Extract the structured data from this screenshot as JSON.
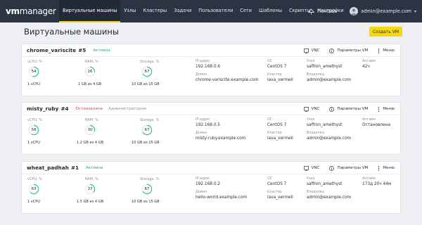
{
  "brand": {
    "logo_vm": "vm",
    "logo_manager": "manager"
  },
  "nav": [
    {
      "label": "Виртуальные машины",
      "active": true
    },
    {
      "label": "Узлы"
    },
    {
      "label": "Кластеры"
    },
    {
      "label": "Задачи"
    },
    {
      "label": "Пользователи"
    },
    {
      "label": "Сети"
    },
    {
      "label": "Шаблоны"
    },
    {
      "label": "Скрипты"
    },
    {
      "label": "Настройки"
    }
  ],
  "header": {
    "help_label": "Помощь",
    "user_email": "admin@example.com"
  },
  "page": {
    "title": "Виртуальные машины",
    "create_button": "Создать VM"
  },
  "labels": {
    "vcpu": "vCPU, %",
    "ram": "RAM, %",
    "storage": "Storage, %",
    "ip": "IP-адрес",
    "domain": "Домен",
    "os": "ОС",
    "cluster": "Кластер",
    "node": "Узел",
    "owner": "Владелец",
    "uptime": "Аптайм",
    "vnc": "VNC",
    "params": "Параметры VM",
    "menu": "Меню"
  },
  "vms": [
    {
      "name": "chrome_variscite",
      "number": "#5",
      "status": "Активна",
      "status_kind": "ok",
      "status_sub": "",
      "cpu_pct": "54",
      "cpu_foot": "1 vCPU",
      "ram_pct": "26",
      "ram_foot": "1 GB из 4 GB",
      "storage_pct": "67",
      "storage_foot": "10 GB из 15 GB",
      "ip": "192.168.0.6",
      "domain": "chrome-variscite.example.com",
      "os": "CentOS 7",
      "cluster": "lava_vermeil",
      "node": "saffron_amethyst",
      "owner": "admin@example.com",
      "uptime": "42ч"
    },
    {
      "name": "misty_ruby",
      "number": "#4",
      "status": "Остановлена",
      "status_kind": "off",
      "status_sub": "Администратором",
      "cpu_pct": "58",
      "cpu_foot": "1 vCPU",
      "ram_pct": "30",
      "ram_foot": "1.2 GB из 4 GB",
      "storage_pct": "67",
      "storage_foot": "10 GB из 15 GB",
      "ip": "192.168.0.5",
      "domain": "misty-ruby.example.com",
      "os": "CentOS 7",
      "cluster": "lava_vermeil",
      "node": "saffron_amethyst",
      "owner": "admin@example.com",
      "uptime": "Остановлена"
    },
    {
      "name": "wheat_padhah",
      "number": "#1",
      "status": "Активна",
      "status_kind": "ok",
      "status_sub": "",
      "cpu_pct": "63",
      "cpu_foot": "1 vCPU",
      "ram_pct": "37",
      "ram_foot": "1.5 GB из 4 GB",
      "storage_pct": "67",
      "storage_foot": "10 GB из 15 GB",
      "ip": "192.168.0.2",
      "domain": "hello-world.example.com",
      "os": "CentOS 7",
      "cluster": "lava_vermeil",
      "node": "saffron_amethyst",
      "owner": "admin@example.com",
      "uptime": "173д 20ч 44м"
    }
  ],
  "colors": {
    "topbar": "#2c3443",
    "accent": "#f5d90a",
    "ring": "#3cc28a",
    "active_status": "#2fa86b",
    "stopped_status": "#e0453f"
  }
}
